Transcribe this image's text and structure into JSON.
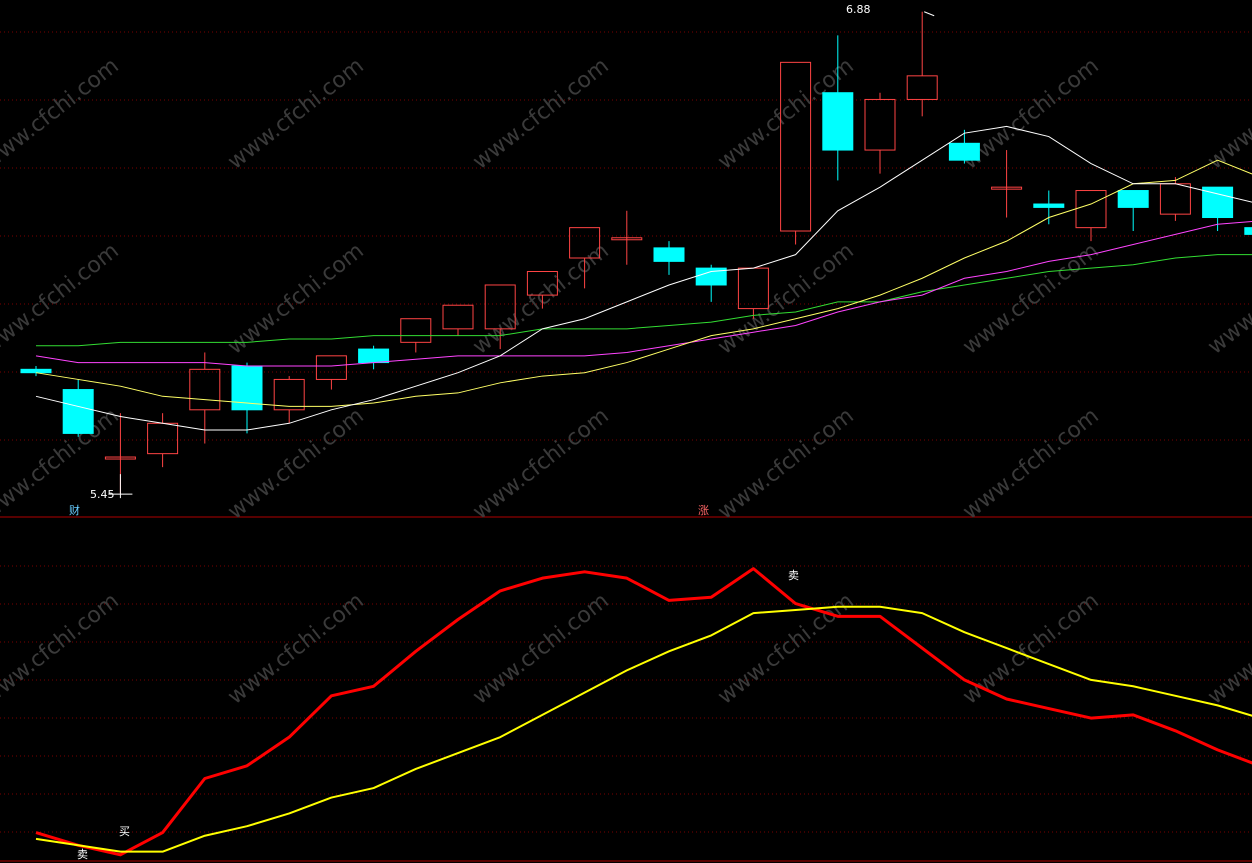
{
  "colors": {
    "background": "#000000",
    "grid": "#7a0000",
    "separator": "#b00000",
    "candle_up": "#ff4444",
    "candle_down": "#00ffff",
    "ma_white": "#ffffff",
    "ma_yellow": "#ffff66",
    "ma_magenta": "#ff44ff",
    "ma_green": "#33dd33",
    "osc_red": "#ff0000",
    "osc_yellow": "#ffff00"
  },
  "watermark": "www.cfchi.com",
  "annotations": {
    "high_label": "6.88",
    "low_label": "5.45",
    "event_cai": "财",
    "event_zhang": "涨",
    "osc_buy": "买",
    "osc_sell_1": "卖",
    "osc_sell_2": "卖"
  },
  "chart_data": [
    {
      "type": "candlestick",
      "price_range": [
        5.4,
        6.9
      ],
      "high": 6.88,
      "low": 5.45,
      "candles": [
        {
          "o": 5.82,
          "h": 5.83,
          "l": 5.8,
          "c": 5.81
        },
        {
          "o": 5.76,
          "h": 5.79,
          "l": 5.62,
          "c": 5.63
        },
        {
          "o": 5.56,
          "h": 5.69,
          "l": 5.45,
          "c": 5.56
        },
        {
          "o": 5.57,
          "h": 5.69,
          "l": 5.53,
          "c": 5.66
        },
        {
          "o": 5.7,
          "h": 5.87,
          "l": 5.6,
          "c": 5.82
        },
        {
          "o": 5.83,
          "h": 5.84,
          "l": 5.63,
          "c": 5.7
        },
        {
          "o": 5.7,
          "h": 5.8,
          "l": 5.66,
          "c": 5.79
        },
        {
          "o": 5.79,
          "h": 5.85,
          "l": 5.76,
          "c": 5.86
        },
        {
          "o": 5.88,
          "h": 5.89,
          "l": 5.82,
          "c": 5.84
        },
        {
          "o": 5.9,
          "h": 5.96,
          "l": 5.87,
          "c": 5.97
        },
        {
          "o": 5.94,
          "h": 5.98,
          "l": 5.92,
          "c": 6.01
        },
        {
          "o": 5.94,
          "h": 6.03,
          "l": 5.88,
          "c": 6.07
        },
        {
          "o": 6.04,
          "h": 6.09,
          "l": 6.0,
          "c": 6.11
        },
        {
          "o": 6.15,
          "h": 6.23,
          "l": 6.06,
          "c": 6.24
        },
        {
          "o": 6.21,
          "h": 6.29,
          "l": 6.13,
          "c": 6.21
        },
        {
          "o": 6.18,
          "h": 6.2,
          "l": 6.1,
          "c": 6.14
        },
        {
          "o": 6.12,
          "h": 6.13,
          "l": 6.02,
          "c": 6.07
        },
        {
          "o": 6.0,
          "h": 6.11,
          "l": 5.97,
          "c": 6.12
        },
        {
          "o": 6.23,
          "h": 6.57,
          "l": 6.19,
          "c": 6.73
        },
        {
          "o": 6.64,
          "h": 6.81,
          "l": 6.38,
          "c": 6.47
        },
        {
          "o": 6.47,
          "h": 6.64,
          "l": 6.4,
          "c": 6.62
        },
        {
          "o": 6.62,
          "h": 6.88,
          "l": 6.57,
          "c": 6.69
        },
        {
          "o": 6.49,
          "h": 6.53,
          "l": 6.43,
          "c": 6.44
        },
        {
          "o": 6.36,
          "h": 6.47,
          "l": 6.27,
          "c": 6.36
        },
        {
          "o": 6.31,
          "h": 6.35,
          "l": 6.25,
          "c": 6.3
        },
        {
          "o": 6.24,
          "h": 6.35,
          "l": 6.2,
          "c": 6.35
        },
        {
          "o": 6.35,
          "h": 6.34,
          "l": 6.23,
          "c": 6.3
        },
        {
          "o": 6.28,
          "h": 6.39,
          "l": 6.26,
          "c": 6.37
        },
        {
          "o": 6.36,
          "h": 6.33,
          "l": 6.23,
          "c": 6.27
        },
        {
          "o": 6.24,
          "h": 6.28,
          "l": 6.21,
          "c": 6.22
        }
      ],
      "ma_white": [
        5.74,
        5.71,
        5.68,
        5.66,
        5.64,
        5.64,
        5.66,
        5.7,
        5.73,
        5.77,
        5.81,
        5.86,
        5.94,
        5.97,
        6.02,
        6.07,
        6.11,
        6.12,
        6.16,
        6.29,
        6.36,
        6.44,
        6.52,
        6.54,
        6.51,
        6.43,
        6.37,
        6.37,
        6.34,
        6.31
      ],
      "ma_yellow": [
        5.81,
        5.79,
        5.77,
        5.74,
        5.73,
        5.72,
        5.71,
        5.71,
        5.72,
        5.74,
        5.75,
        5.78,
        5.8,
        5.81,
        5.84,
        5.88,
        5.92,
        5.94,
        5.97,
        6.0,
        6.04,
        6.09,
        6.15,
        6.2,
        6.27,
        6.31,
        6.37,
        6.38,
        6.44,
        6.39
      ],
      "ma_magenta": [
        5.86,
        5.84,
        5.84,
        5.84,
        5.84,
        5.83,
        5.83,
        5.83,
        5.84,
        5.85,
        5.86,
        5.86,
        5.86,
        5.86,
        5.87,
        5.89,
        5.91,
        5.93,
        5.95,
        5.99,
        6.02,
        6.04,
        6.09,
        6.11,
        6.14,
        6.16,
        6.19,
        6.22,
        6.25,
        6.26
      ],
      "ma_green": [
        5.89,
        5.89,
        5.9,
        5.9,
        5.9,
        5.9,
        5.91,
        5.91,
        5.92,
        5.92,
        5.92,
        5.92,
        5.94,
        5.94,
        5.94,
        5.95,
        5.96,
        5.98,
        5.99,
        6.02,
        6.02,
        6.05,
        6.07,
        6.09,
        6.11,
        6.12,
        6.13,
        6.15,
        6.16,
        6.16
      ]
    },
    {
      "type": "line",
      "y_range": [
        0,
        100
      ],
      "series": [
        {
          "color_key": "osc_red",
          "values": [
            8,
            4,
            1,
            8,
            25,
            29,
            38,
            51,
            54,
            65,
            75,
            84,
            88,
            90,
            88,
            81,
            82,
            91,
            80,
            76,
            76,
            66,
            56,
            50,
            47,
            44,
            45,
            40,
            34,
            29
          ]
        },
        {
          "color_key": "osc_yellow",
          "values": [
            6,
            4,
            2,
            2,
            7,
            10,
            14,
            19,
            22,
            28,
            33,
            38,
            45,
            52,
            59,
            65,
            70,
            77,
            78,
            79,
            79,
            77,
            71,
            66,
            61,
            56,
            54,
            51,
            48,
            44
          ]
        }
      ]
    }
  ]
}
